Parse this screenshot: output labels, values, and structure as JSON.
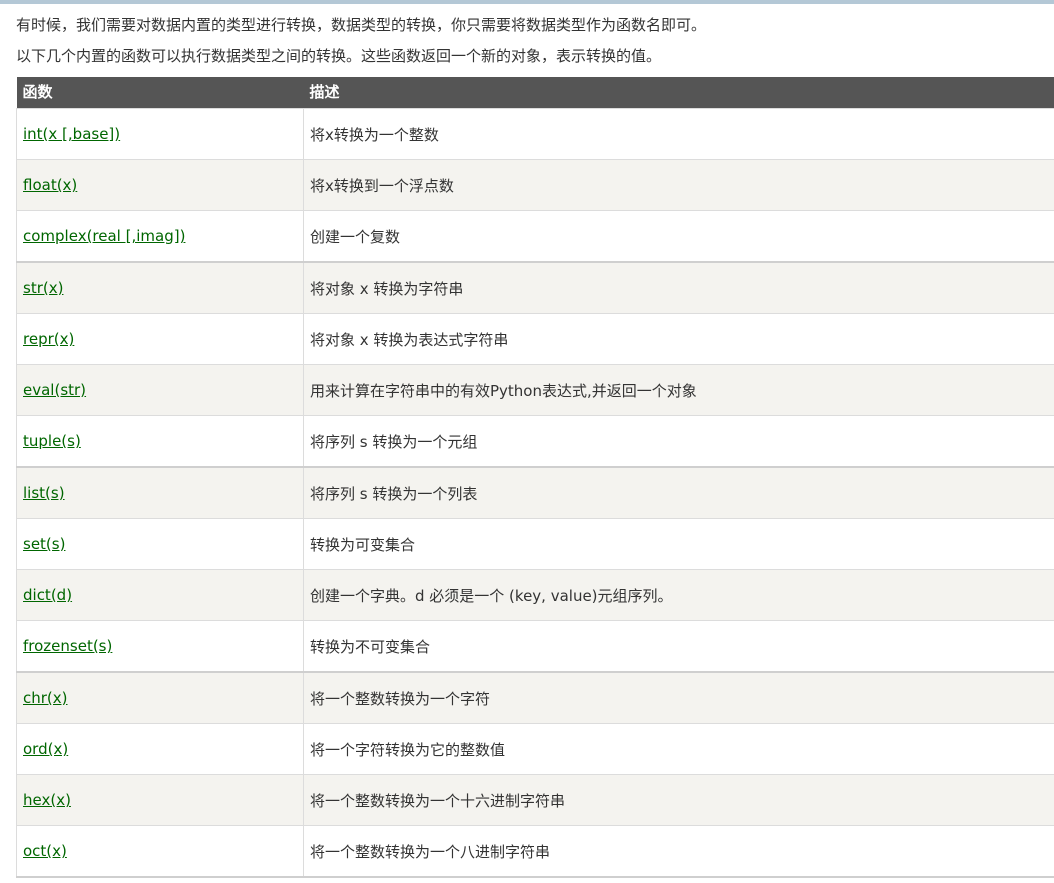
{
  "intro": {
    "line1": "有时候，我们需要对数据内置的类型进行转换，数据类型的转换，你只需要将数据类型作为函数名即可。",
    "line2": "以下几个内置的函数可以执行数据类型之间的转换。这些函数返回一个新的对象，表示转换的值。"
  },
  "table": {
    "headers": {
      "function": "函数",
      "description": "描述"
    },
    "rows": [
      {
        "fn": "int(x [,base])",
        "desc": "将x转换为一个整数"
      },
      {
        "fn": "float(x)",
        "desc": "将x转换到一个浮点数"
      },
      {
        "fn": "complex(real [,imag])",
        "desc": "创建一个复数"
      },
      {
        "fn": "str(x)",
        "desc": "将对象 x 转换为字符串"
      },
      {
        "fn": "repr(x)",
        "desc": "将对象 x 转换为表达式字符串"
      },
      {
        "fn": "eval(str)",
        "desc": "用来计算在字符串中的有效Python表达式,并返回一个对象"
      },
      {
        "fn": "tuple(s)",
        "desc": "将序列 s 转换为一个元组"
      },
      {
        "fn": "list(s)",
        "desc": "将序列 s 转换为一个列表"
      },
      {
        "fn": "set(s)",
        "desc": "转换为可变集合"
      },
      {
        "fn": "dict(d)",
        "desc": "创建一个字典。d 必须是一个 (key, value)元组序列。"
      },
      {
        "fn": "frozenset(s)",
        "desc": "转换为不可变集合"
      },
      {
        "fn": "chr(x)",
        "desc": "将一个整数转换为一个字符"
      },
      {
        "fn": "ord(x)",
        "desc": "将一个字符转换为它的整数值"
      },
      {
        "fn": "hex(x)",
        "desc": "将一个整数转换为一个十六进制字符串"
      },
      {
        "fn": "oct(x)",
        "desc": "将一个整数转换为一个八进制字符串"
      }
    ]
  }
}
